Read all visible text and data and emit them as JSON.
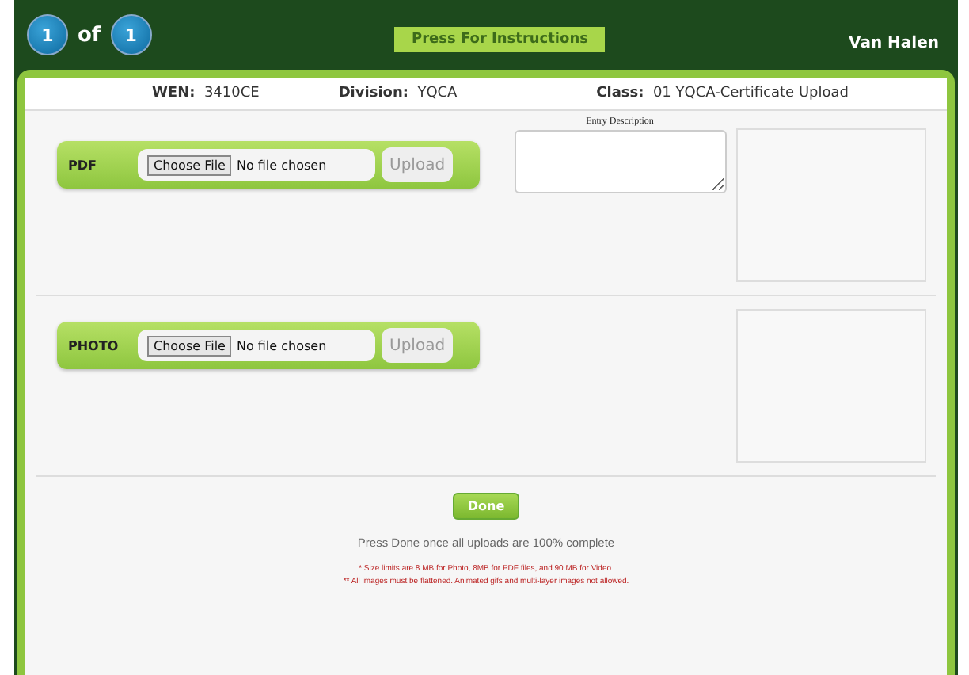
{
  "pager": {
    "current": "1",
    "separator": "of",
    "total": "1"
  },
  "instructions_button": "Press For Instructions",
  "user": "Van Halen",
  "info": [
    {
      "label": "WEN:",
      "value": "3410CE"
    },
    {
      "label": "Division:",
      "value": "YQCA"
    },
    {
      "label": "Class:",
      "value": "01 YQCA-Certificate Upload"
    }
  ],
  "uploads": [
    {
      "label": "PDF",
      "choose_button": "Choose File",
      "file_status": "No file chosen",
      "upload_button": "Upload",
      "upload_disabled": true,
      "description_label": "Entry Description"
    },
    {
      "label": "PHOTO",
      "choose_button": "Choose File",
      "file_status": "No file chosen",
      "upload_button": "Upload",
      "upload_disabled": true
    }
  ],
  "done_button": "Done",
  "done_hint": "Press Done once all uploads are 100% complete",
  "notes": [
    "* Size limits are 8 MB for Photo, 8MB for PDF files, and 90 MB for Video.",
    "** All images must be flattened.  Animated gifs and multi-layer images not allowed."
  ]
}
